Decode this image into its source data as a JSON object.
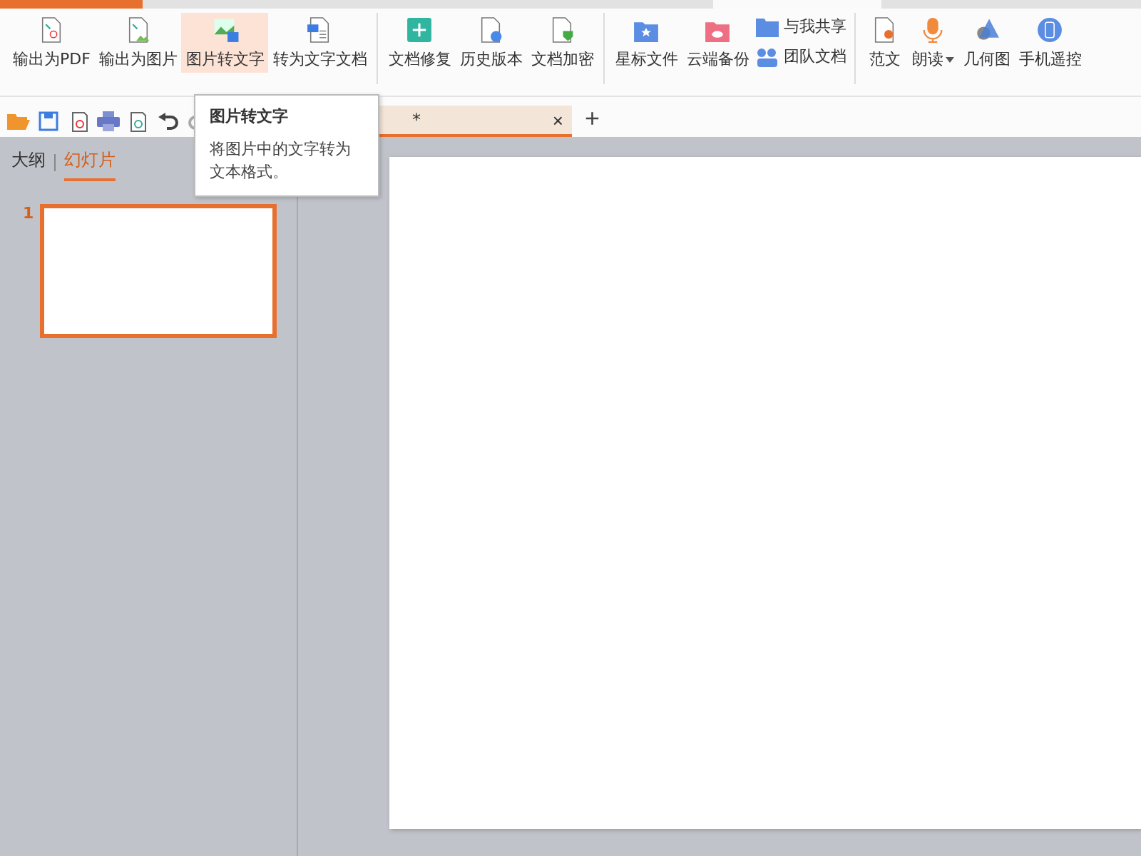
{
  "ribbon": {
    "groups": [
      {
        "items": [
          {
            "kind": "large",
            "label": "输出为PDF",
            "selected": false
          },
          {
            "kind": "large",
            "label": "输出为图片",
            "selected": false
          },
          {
            "kind": "large",
            "label": "图片转文字",
            "selected": true
          },
          {
            "kind": "large",
            "label": "转为文字文档",
            "selected": false
          }
        ]
      },
      {
        "items": [
          {
            "kind": "large",
            "label": "文档修复",
            "selected": false
          },
          {
            "kind": "large",
            "label": "历史版本",
            "selected": false
          },
          {
            "kind": "large",
            "label": "文档加密",
            "selected": false
          }
        ]
      },
      {
        "items": [
          {
            "kind": "large",
            "label": "星标文件",
            "selected": false
          },
          {
            "kind": "large",
            "label": "云端备份",
            "selected": false
          },
          {
            "kind": "stack",
            "entries": [
              {
                "label": "与我共享"
              },
              {
                "label": "团队文档"
              }
            ]
          }
        ]
      },
      {
        "items": [
          {
            "kind": "large",
            "label": "范文",
            "selected": false
          },
          {
            "kind": "large",
            "label": "朗读",
            "selected": false,
            "dropdown": true
          },
          {
            "kind": "large",
            "label": "几何图",
            "selected": false
          },
          {
            "kind": "large",
            "label": "手机遥控",
            "selected": false
          }
        ]
      }
    ]
  },
  "document_tab": {
    "title": "*",
    "close": "×",
    "new_tab": "+"
  },
  "tooltip": {
    "title": "图片转文字",
    "body": "将图片中的文字转为文本格式。"
  },
  "panel_tabs": [
    {
      "label": "大纲",
      "selected": false
    },
    {
      "label": "幻灯片",
      "selected": true
    }
  ],
  "slides": [
    {
      "number": "1",
      "selected": true
    }
  ]
}
